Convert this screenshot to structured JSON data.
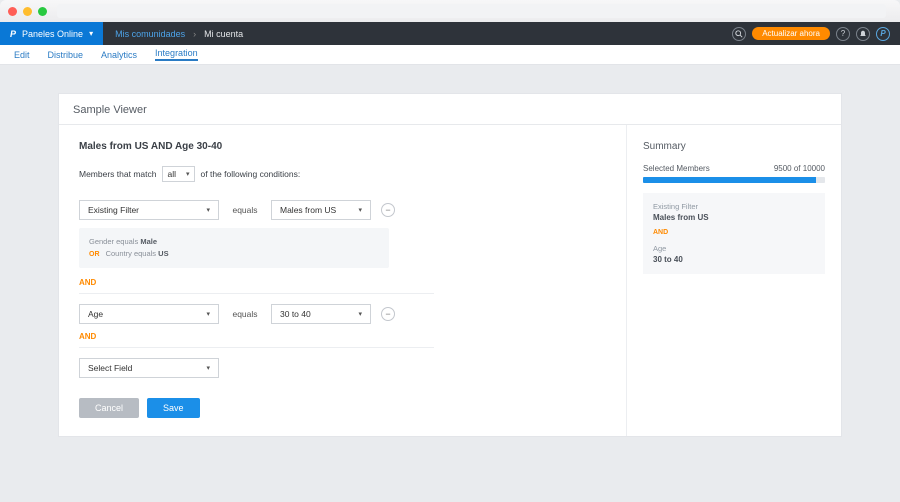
{
  "brand": {
    "initial": "P",
    "name": "Paneles Online"
  },
  "breadcrumbs": {
    "community": "Mis comunidades",
    "account": "Mi cuenta"
  },
  "top_actions": {
    "cta": "Actualizar ahora"
  },
  "subnav": {
    "edit": "Edit",
    "distribute": "Distribue",
    "analytics": "Analytics",
    "integration": "Integration"
  },
  "panel": {
    "title": "Sample Viewer"
  },
  "filter": {
    "name": "Males from US AND Age 30-40",
    "members_that_match": "Members that match",
    "match_mode": "all",
    "of_following": "of the following conditions:",
    "conditions": [
      {
        "field": "Existing Filter",
        "operator": "equals",
        "value": "Males from US",
        "sub": {
          "line1_label": "Gender",
          "line1_op": "equals",
          "line1_val": "Male",
          "line2_prefix": "OR",
          "line2_label": "Country",
          "line2_op": "equals",
          "line2_val": "US"
        }
      },
      {
        "field": "Age",
        "operator": "equals",
        "value": "30 to 40"
      },
      {
        "field": "Select Field"
      }
    ],
    "and_word": "AND"
  },
  "buttons": {
    "cancel": "Cancel",
    "save": "Save"
  },
  "summary": {
    "title": "Summary",
    "selected_label": "Selected Members",
    "selected_value": "9500 of 10000",
    "progress_pct": 95,
    "card": {
      "f1_label": "Existing Filter",
      "f1_value": "Males from US",
      "and": "AND",
      "f2_label": "Age",
      "f2_value": "30 to 40"
    }
  }
}
